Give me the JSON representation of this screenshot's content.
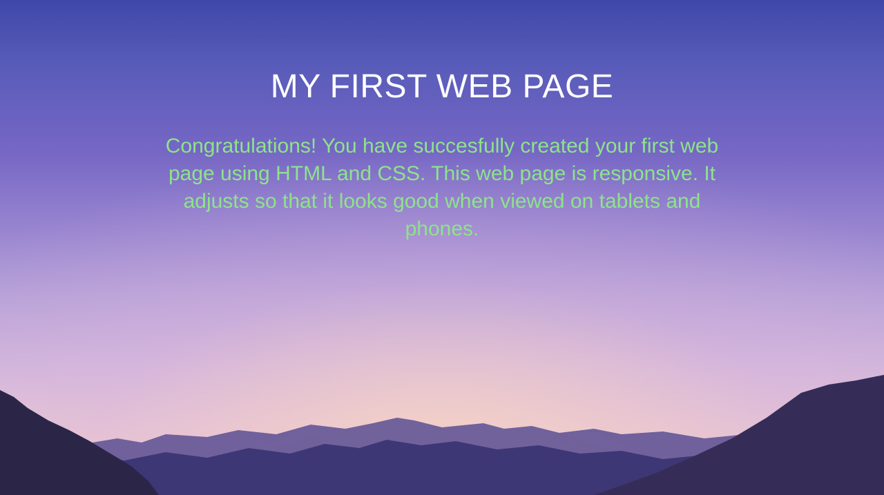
{
  "page": {
    "title": "MY FIRST WEB PAGE",
    "message": "Congratulations! You have succesfully created your first web page using HTML and CSS. This web page is responsive. It adjusts so that it looks good when viewed on tablets and phones."
  },
  "colors": {
    "title": "#ffffff",
    "message": "#8de48a",
    "sky_top": "#3f48a8",
    "sky_bottom": "#efcdc6",
    "mountains": "#2e2a55"
  },
  "background": {
    "image": "mountain-sunset-image"
  }
}
